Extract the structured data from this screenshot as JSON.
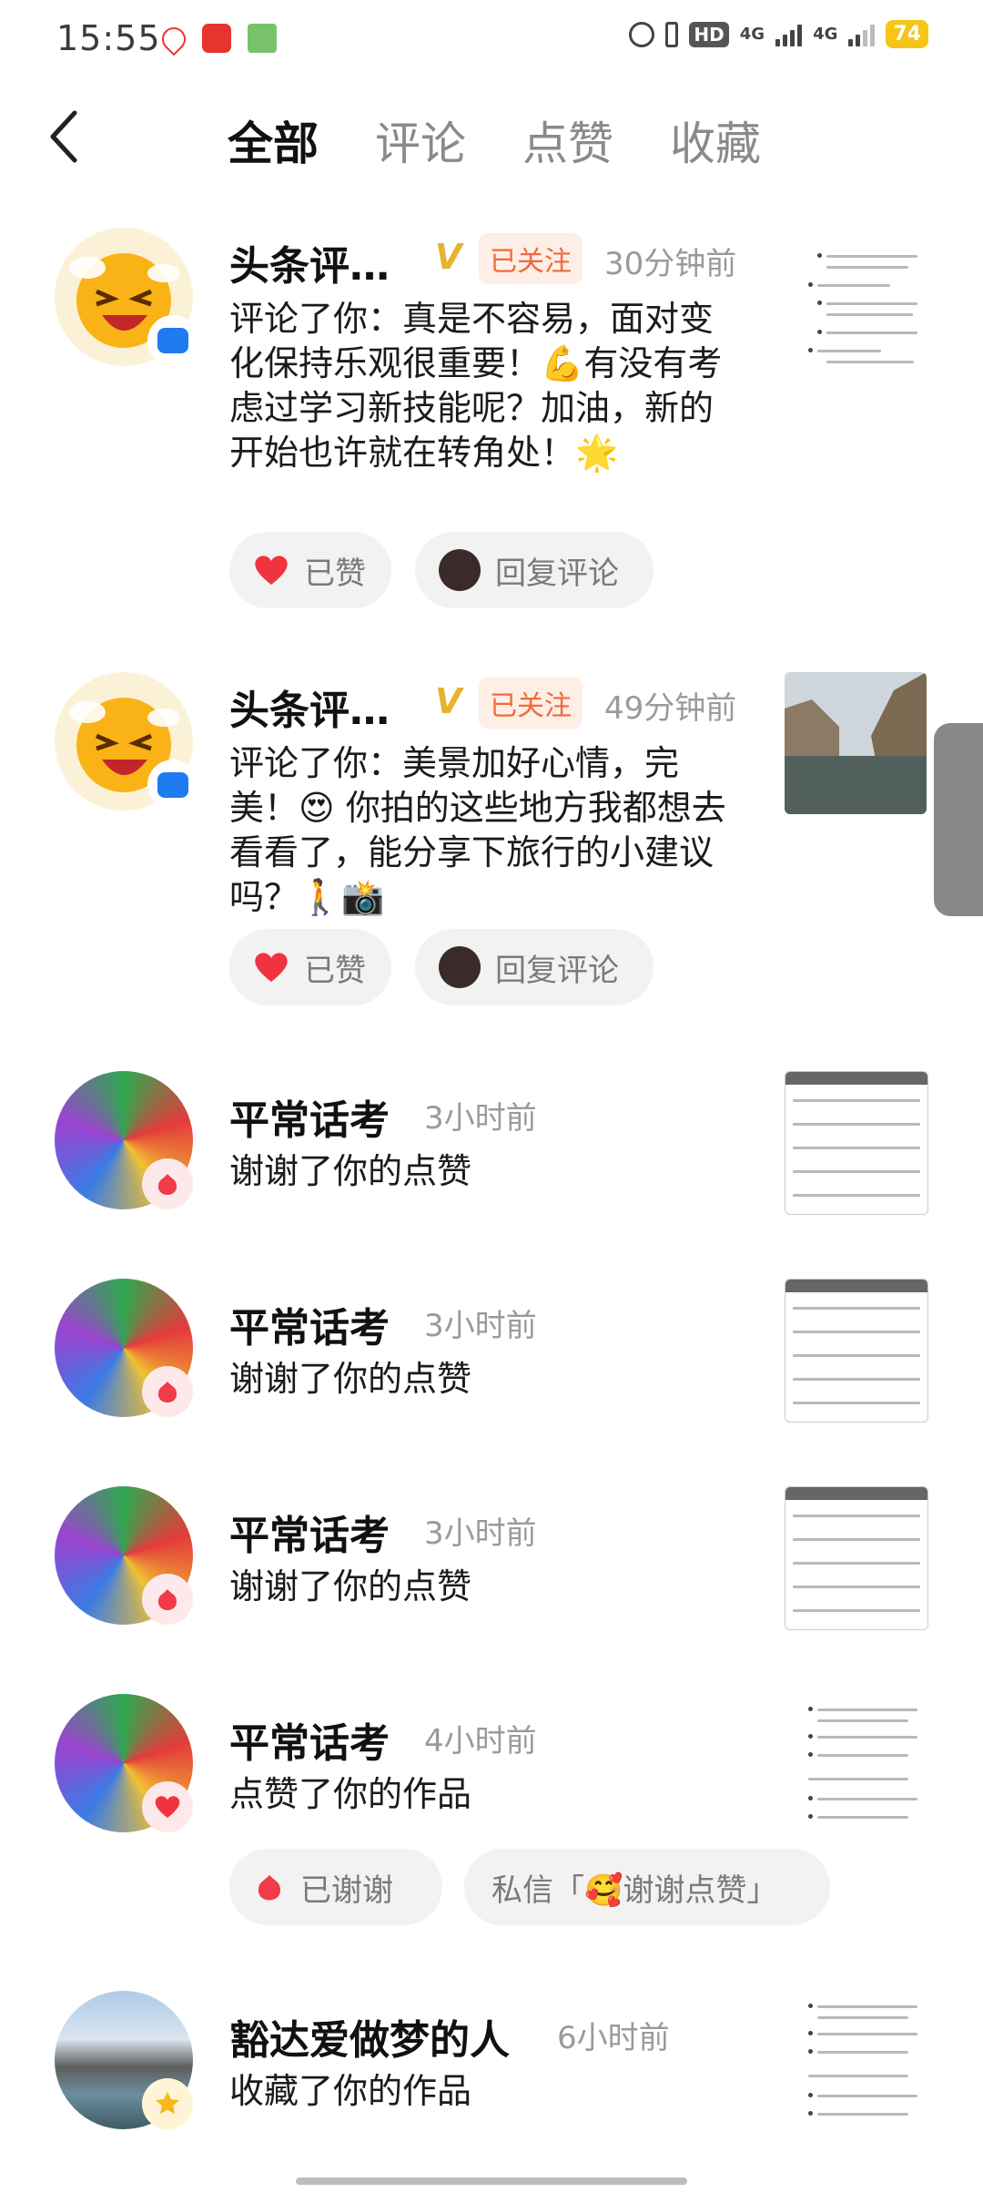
{
  "status_bar": {
    "time": "15:55",
    "network": [
      "4G",
      "4G"
    ],
    "hd": "HD",
    "battery": "74"
  },
  "tabs": [
    "全部",
    "评论",
    "点赞",
    "收藏"
  ],
  "items": [
    {
      "name": "头条评…",
      "followed": "已关注",
      "time": "30分钟前",
      "text": "评论了你：真是不容易，面对变化保持乐观很重要！💪有没有考虑过学习新技能呢？加油，新的开始也许就在转角处！🌟",
      "like_label": "已赞",
      "reply_label": "回复评论",
      "badge": "comment-badge-icon"
    },
    {
      "name": "头条评…",
      "followed": "已关注",
      "time": "49分钟前",
      "text": "评论了你：美景加好心情，完美！😍 你拍的这些地方我都想去看看了，能分享下旅行的小建议吗？🚶📸",
      "like_label": "已赞",
      "reply_label": "回复评论",
      "badge": "comment-badge-icon"
    },
    {
      "name": "平常话考",
      "time": "3小时前",
      "text": "谢谢了你的点赞"
    },
    {
      "name": "平常话考",
      "time": "3小时前",
      "text": "谢谢了你的点赞"
    },
    {
      "name": "平常话考",
      "time": "3小时前",
      "text": "谢谢了你的点赞"
    },
    {
      "name": "平常话考",
      "time": "4小时前",
      "text": "点赞了你的作品",
      "thanked_label": "已谢谢",
      "dm_label": "私信「🥰谢谢点赞」"
    },
    {
      "name": "豁达爱做梦的人",
      "time": "6小时前",
      "text": "收藏了你的作品"
    }
  ],
  "colors": {
    "accent_like": "#f0343f",
    "follow_bg": "#fdeee6",
    "follow_text": "#ef6a3c",
    "verified": "#e6b230",
    "comment_badge": "#1e7bf0"
  }
}
